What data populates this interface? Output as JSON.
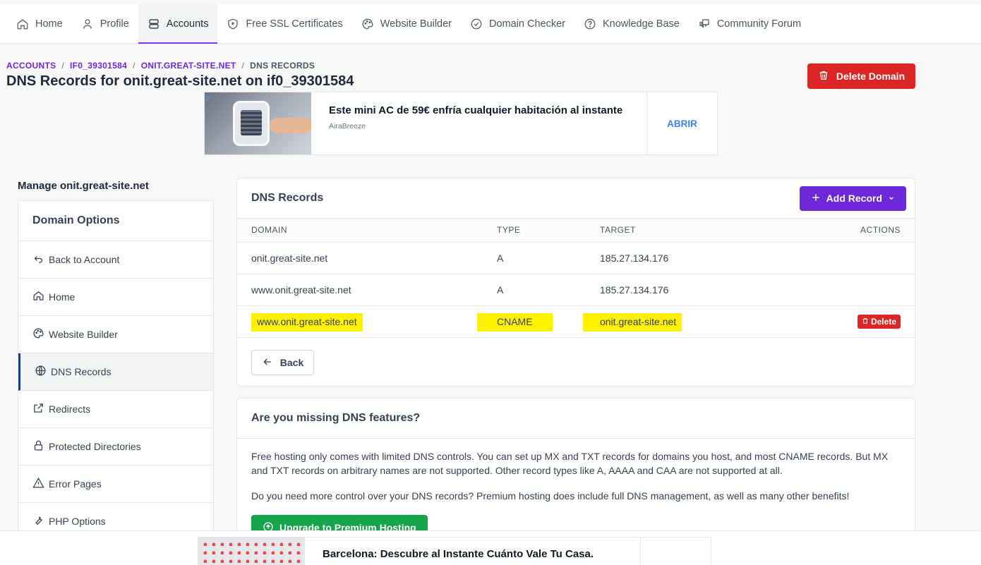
{
  "nav": {
    "items": [
      {
        "label": "Home",
        "icon": "home-icon",
        "active": false
      },
      {
        "label": "Profile",
        "icon": "user-icon",
        "active": false
      },
      {
        "label": "Accounts",
        "icon": "server-icon",
        "active": true
      },
      {
        "label": "Free SSL Certificates",
        "icon": "shield-icon",
        "active": false
      },
      {
        "label": "Website Builder",
        "icon": "palette-icon",
        "active": false
      },
      {
        "label": "Domain Checker",
        "icon": "check-circle-icon",
        "active": false
      },
      {
        "label": "Knowledge Base",
        "icon": "question-circle-icon",
        "active": false
      },
      {
        "label": "Community Forum",
        "icon": "chat-icon",
        "active": false
      }
    ]
  },
  "breadcrumb": {
    "items": [
      "ACCOUNTS",
      "IF0_39301584",
      "ONIT.GREAT-SITE.NET"
    ],
    "current": "DNS RECORDS",
    "separator": "/"
  },
  "page": {
    "title": "DNS Records for onit.great-site.net on if0_39301584",
    "delete_domain_label": "Delete Domain"
  },
  "ad": {
    "headline": "Este mini AC de 59€ enfría cualquier habitación al instante",
    "brand": "AiraBreeze",
    "cta": "ABRIR"
  },
  "sidebar": {
    "manage_title": "Manage onit.great-site.net",
    "panel_title": "Domain Options",
    "items": [
      {
        "label": "Back to Account",
        "icon": "back-arrow-icon"
      },
      {
        "label": "Home",
        "icon": "home-icon"
      },
      {
        "label": "Website Builder",
        "icon": "palette-icon"
      },
      {
        "label": "DNS Records",
        "icon": "globe-icon",
        "active": true
      },
      {
        "label": "Redirects",
        "icon": "external-link-icon"
      },
      {
        "label": "Protected Directories",
        "icon": "lock-icon"
      },
      {
        "label": "Error Pages",
        "icon": "warning-icon"
      },
      {
        "label": "PHP Options",
        "icon": "wrench-icon"
      }
    ]
  },
  "dns": {
    "title": "DNS Records",
    "add_record_label": "Add Record",
    "columns": [
      "DOMAIN",
      "TYPE",
      "TARGET",
      "ACTIONS"
    ],
    "rows": [
      {
        "domain": "onit.great-site.net",
        "type": "A",
        "target": "185.27.134.176",
        "action": "",
        "highlight": false
      },
      {
        "domain": "www.onit.great-site.net",
        "type": "A",
        "target": "185.27.134.176",
        "action": "",
        "highlight": false
      },
      {
        "domain": "www.onit.great-site.net",
        "type": "CNAME",
        "target": "onit.great-site.net",
        "action": "Delete",
        "highlight": true
      }
    ],
    "back_label": "Back"
  },
  "info": {
    "title": "Are you missing DNS features?",
    "paragraph1": "Free hosting only comes with limited DNS controls. You can set up MX and TXT records for domains you host, and most CNAME records. But MX and TXT records on arbitrary names are not supported. Other record types like A, AAAA and CAA are not supported at all.",
    "paragraph2": "Do you need more control over your DNS records? Premium hosting does include full DNS management, as well as many other benefits!",
    "upgrade_label": "Upgrade to Premium Hosting"
  },
  "bottom_ad": {
    "headline": "Barcelona: Descubre al Instante Cuánto Vale Tu Casa."
  },
  "colors": {
    "accent_purple": "#6d28d9",
    "danger_red": "#dc2626",
    "success_green": "#16a34a",
    "highlight_yellow": "#fff200"
  }
}
